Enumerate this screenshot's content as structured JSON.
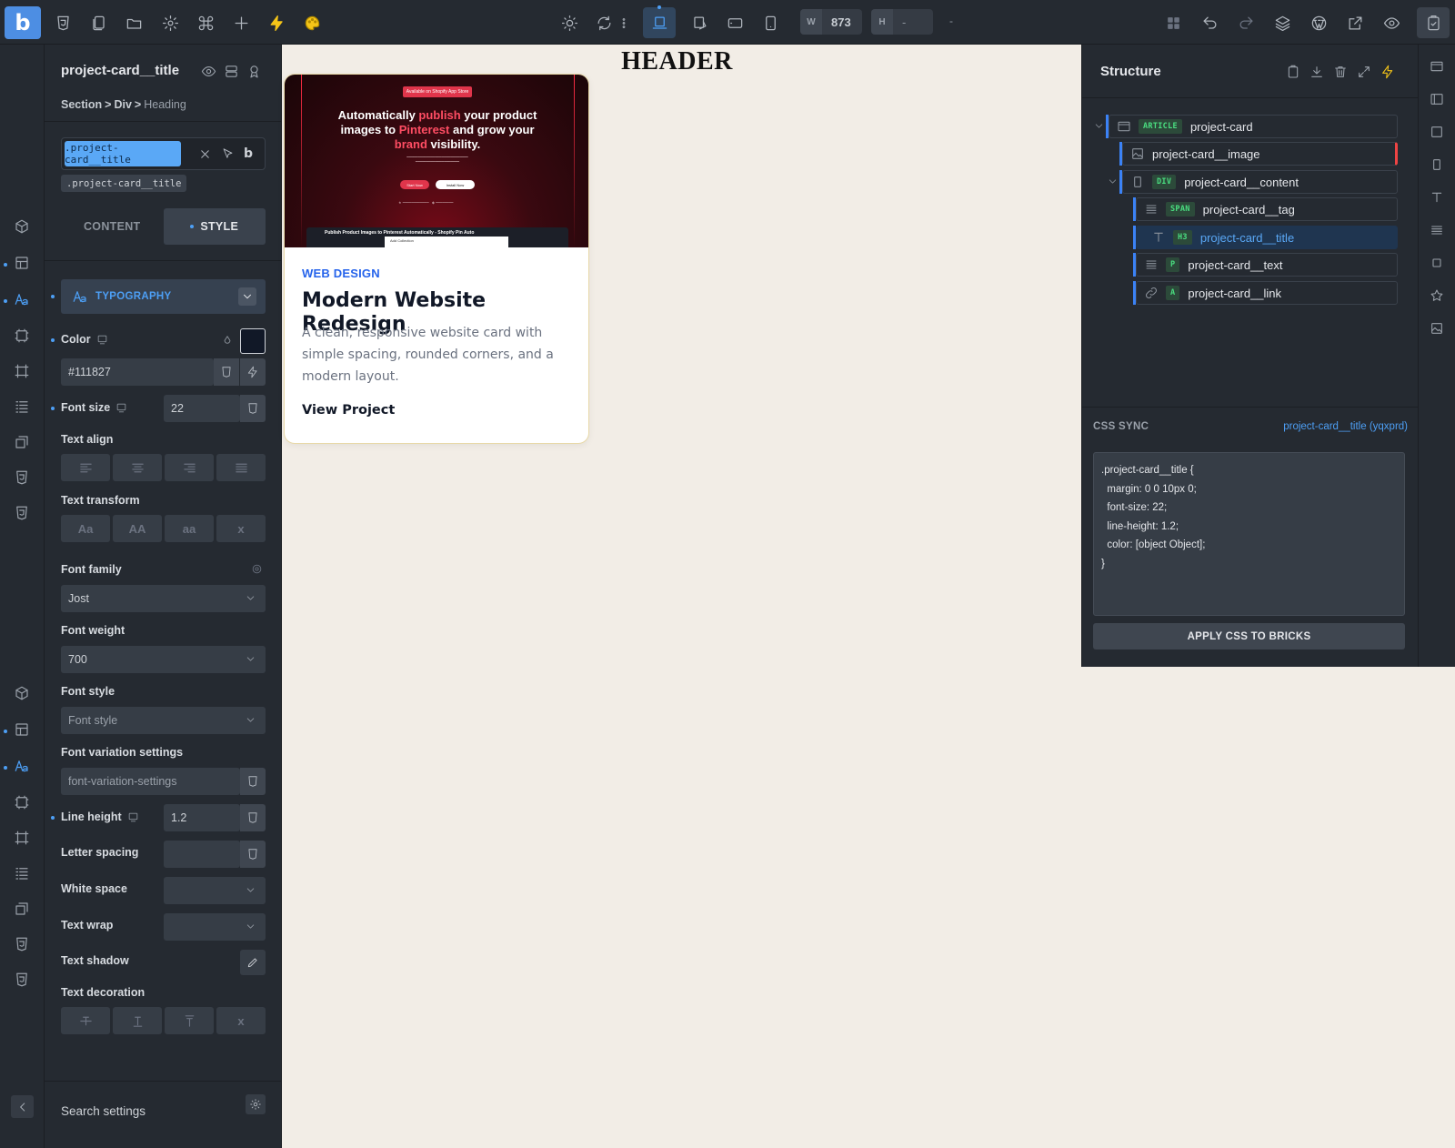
{
  "topbar": {
    "logo": "b",
    "width_label": "W",
    "width_value": "873",
    "height_label": "H",
    "height_value": "-",
    "extra_value": "-",
    "icons": [
      "templates-icon",
      "pages-icon",
      "folder-icon",
      "settings-icon",
      "command-icon",
      "add-icon",
      "lightning-icon",
      "palette-icon",
      "sun-icon",
      "refresh-icon",
      "more-icon",
      "desktop-icon",
      "laptop-icon",
      "tablet-landscape-icon",
      "tablet-portrait-icon",
      "grid-icon",
      "undo-icon",
      "redo-icon",
      "layers-icon",
      "wordpress-icon",
      "external-link-icon",
      "preview-icon",
      "save-icon"
    ]
  },
  "left_panel": {
    "element_title": "project-card__title",
    "breadcrumb": [
      "Section",
      "Div",
      "Heading"
    ],
    "class_chip": ".project-card__title",
    "class_tag": ".project-card__title",
    "tabs": [
      "CONTENT",
      "STYLE"
    ],
    "active_tab": "STYLE",
    "section_title": "TYPOGRAPHY",
    "fields": {
      "color_label": "Color",
      "color_value": "#111827",
      "font_size_label": "Font size",
      "font_size_value": "22",
      "text_align_label": "Text align",
      "text_transform_label": "Text transform",
      "text_transform_options": [
        "Aa",
        "AA",
        "aa",
        "x"
      ],
      "font_family_label": "Font family",
      "font_family_value": "Jost",
      "font_weight_label": "Font weight",
      "font_weight_value": "700",
      "font_style_label": "Font style",
      "font_style_placeholder": "Font style",
      "font_variation_label": "Font variation settings",
      "font_variation_placeholder": "font-variation-settings",
      "line_height_label": "Line height",
      "line_height_value": "1.2",
      "letter_spacing_label": "Letter spacing",
      "white_space_label": "White space",
      "text_wrap_label": "Text wrap",
      "text_shadow_label": "Text shadow",
      "text_decoration_label": "Text decoration",
      "text_decoration_x": "x"
    },
    "search_settings": "Search settings"
  },
  "canvas": {
    "header": "HEADER",
    "card": {
      "image": {
        "badge": "Available on Shopify App Store",
        "headline_1": "Automatically ",
        "headline_hl1": "publish",
        "headline_2": " your product",
        "headline_3": "images to ",
        "headline_hl2": "Pinterest",
        "headline_4": " and grow your",
        "headline_hl3": "brand",
        "headline_5": " visibility.",
        "btn_primary": "Start Now",
        "btn_secondary": "Install Now",
        "strip_title": "Publish Product Images to Pinterest Automatically - Shopify Pin Auto",
        "strip_window": "Add Collection"
      },
      "tag": "WEB DESIGN",
      "title": "Modern Website Redesign",
      "text": "A clean, responsive website card with simple spacing, rounded corners, and a modern layout.",
      "link": "View Project"
    }
  },
  "structure": {
    "title": "Structure",
    "tree": [
      {
        "tag": "",
        "label": "project-card",
        "badge": "ARTICLE"
      },
      {
        "tag": "",
        "label": "project-card__image",
        "badge": ""
      },
      {
        "tag": "",
        "label": "project-card__content",
        "badge": "DIV"
      },
      {
        "tag": "",
        "label": "project-card__tag",
        "badge": "SPAN"
      },
      {
        "tag": "",
        "label": "project-card__title",
        "badge": "H3"
      },
      {
        "tag": "",
        "label": "project-card__text",
        "badge": "P"
      },
      {
        "tag": "",
        "label": "project-card__link",
        "badge": "A"
      }
    ],
    "css_sync": {
      "label": "CSS SYNC",
      "reference": "project-card__title (yqxprd)",
      "code": ".project-card__title {\n  margin: 0 0 10px 0;\n  font-size: 22;\n  line-height: 1.2;\n  color: [object Object];\n}",
      "apply_button": "APPLY CSS TO BRICKS"
    }
  },
  "colors": {
    "panel_bg": "#252a31",
    "accent": "#4d9ff5",
    "canvas_bg": "#f2ede6",
    "title_color": "#111827",
    "tag_color": "#2563eb"
  }
}
